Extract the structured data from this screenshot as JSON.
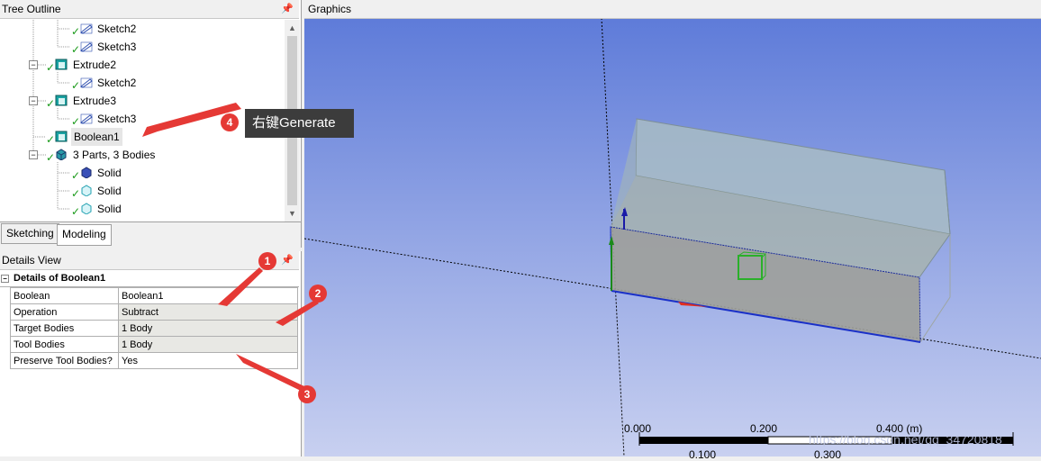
{
  "tree": {
    "title": "Tree Outline",
    "pin": "ᵖ",
    "items": [
      {
        "label": "Sketch2",
        "icon": "sketch-icon"
      },
      {
        "label": "Sketch3",
        "icon": "sketch-icon"
      },
      {
        "label": "Extrude2",
        "icon": "extrude-icon",
        "toggle": "−"
      },
      {
        "label": "Sketch2",
        "icon": "sketch-icon"
      },
      {
        "label": "Extrude3",
        "icon": "extrude-icon",
        "toggle": "−"
      },
      {
        "label": "Sketch3",
        "icon": "sketch-icon"
      },
      {
        "label": "Boolean1",
        "icon": "boolean-icon",
        "selected": true
      },
      {
        "label": "3 Parts, 3 Bodies",
        "icon": "parts-icon",
        "toggle": "−"
      },
      {
        "label": "Solid",
        "icon": "solid-icon"
      },
      {
        "label": "Solid",
        "icon": "solid-icon"
      },
      {
        "label": "Solid",
        "icon": "solid-icon"
      }
    ]
  },
  "tabs": [
    {
      "label": "Sketching"
    },
    {
      "label": "Modeling",
      "active": true
    }
  ],
  "details": {
    "title": "Details View",
    "section": "Details of Boolean1",
    "rows": [
      {
        "name": "Boolean",
        "value": "Boolean1"
      },
      {
        "name": "Operation",
        "value": "Subtract"
      },
      {
        "name": "Target Bodies",
        "value": "1 Body"
      },
      {
        "name": "Tool Bodies",
        "value": "1 Body"
      },
      {
        "name": "Preserve Tool Bodies?",
        "value": "Yes"
      }
    ]
  },
  "graphics": {
    "title": "Graphics",
    "scale": {
      "l0": "0.000",
      "l1": "0.200",
      "l2": "0.400 (m)",
      "l3": "0.100",
      "l4": "0.300"
    },
    "watermark": "https://blog.csdn.net/qq_34720818"
  },
  "annotations": {
    "c1": "1",
    "c2": "2",
    "c3": "3",
    "c4": "4",
    "tooltip": "右键Generate",
    "color": "#e53935"
  },
  "colors": {
    "background_top": "#5a78d8",
    "background_bottom": "#c8d0f0",
    "accent_check": "#1a9a1a"
  }
}
